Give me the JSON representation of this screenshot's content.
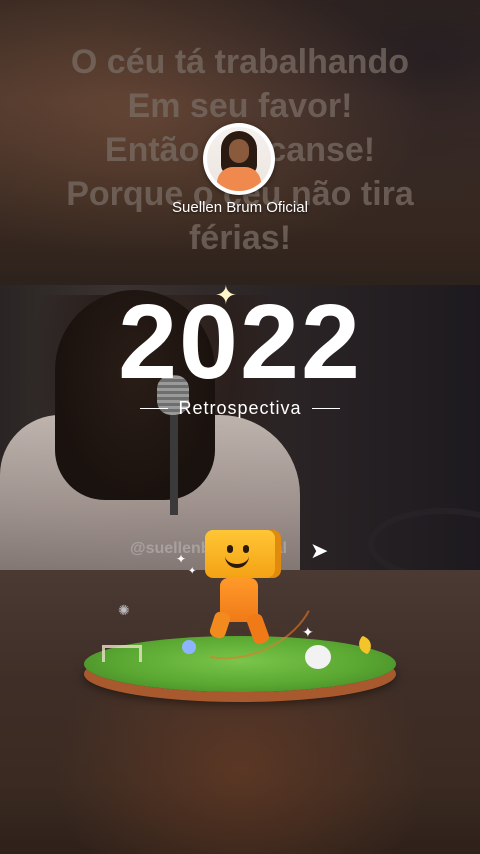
{
  "background_text": {
    "lines": [
      "O céu tá trabalhando",
      "Em seu favor!",
      "Então descanse!",
      "Porque o céu não tira",
      "férias!"
    ]
  },
  "profile": {
    "name": "Suellen Brum Oficial"
  },
  "recap": {
    "year": "2022",
    "subtitle": "Retrospectiva"
  },
  "video": {
    "watermark": "@suellenbrumoficial"
  },
  "colors": {
    "text": "#ffffff",
    "mascot": "#f4a214",
    "grass": "#5aa832"
  }
}
